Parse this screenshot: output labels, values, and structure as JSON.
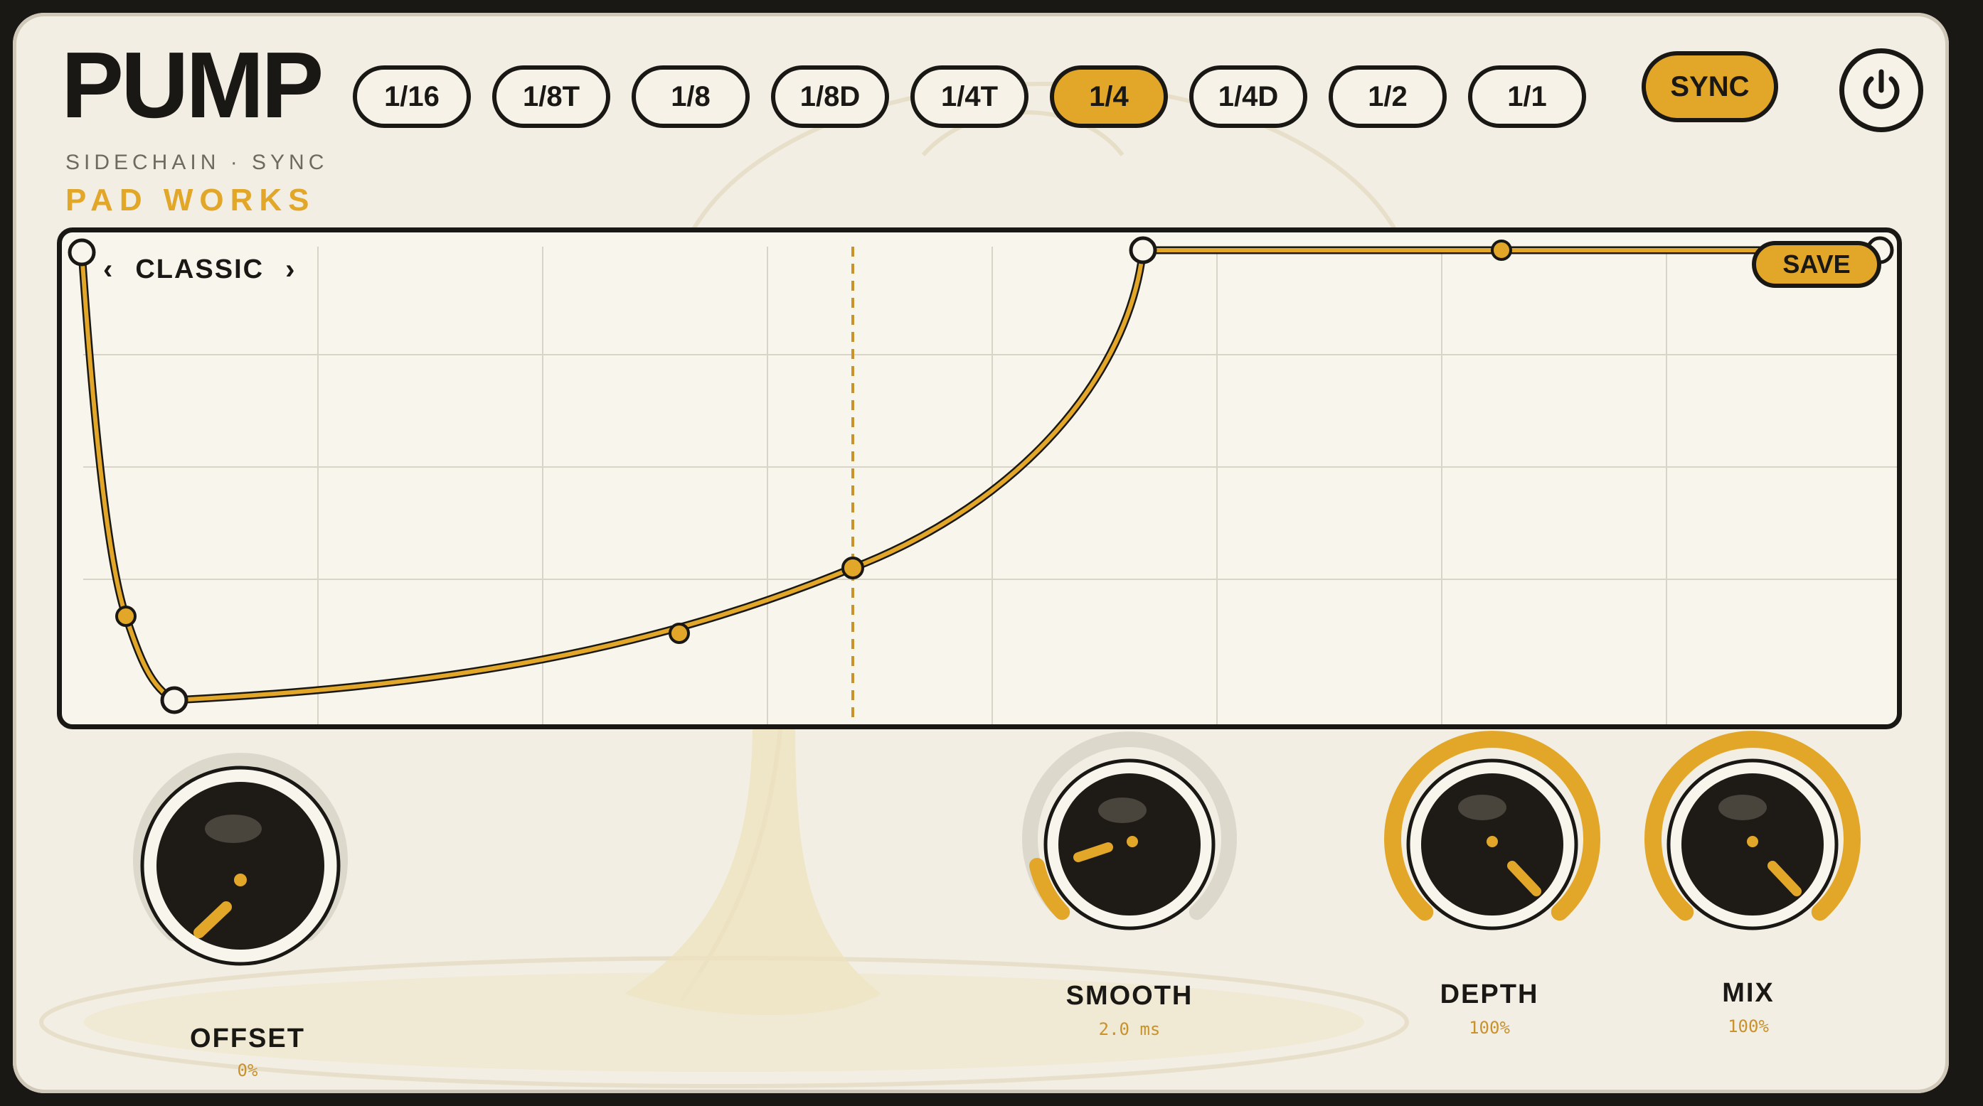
{
  "app": {
    "title": "PUMP",
    "subtitle": "SIDECHAIN · SYNC",
    "brand": "PAD WORKS"
  },
  "rates": {
    "options": [
      "1/16",
      "1/8T",
      "1/8",
      "1/8D",
      "1/4T",
      "1/4",
      "1/4D",
      "1/2",
      "1/1"
    ],
    "selected": "1/4"
  },
  "sync": {
    "label": "SYNC",
    "active": true
  },
  "power": {
    "icon": "power-icon",
    "on": true
  },
  "graph": {
    "preset_prev_icon": "‹",
    "preset_name": "CLASSIC",
    "preset_next_icon": "›",
    "save_label": "SAVE"
  },
  "knobs": {
    "offset": {
      "label": "OFFSET",
      "value": "0%"
    },
    "smooth": {
      "label": "SMOOTH",
      "value": "2.0 ms"
    },
    "depth": {
      "label": "DEPTH",
      "value": "100%"
    },
    "mix": {
      "label": "MIX",
      "value": "100%"
    }
  },
  "colors": {
    "accent": "#e2a729",
    "ink": "#1a1814",
    "panel": "#f2eee3",
    "graph_bg": "#f8f5ec"
  }
}
